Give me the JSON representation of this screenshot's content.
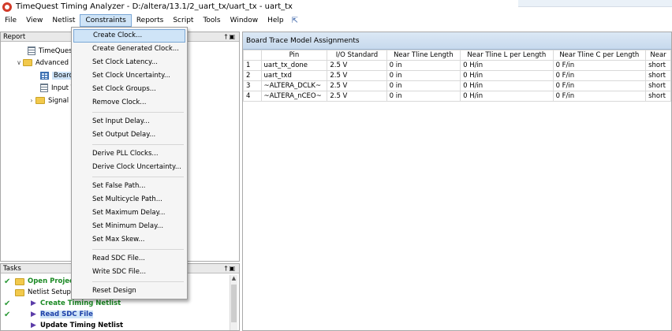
{
  "window": {
    "title": "TimeQuest Timing Analyzer - D:/altera/13.1/2_uart_tx/uart_tx - uart_tx"
  },
  "menubar": {
    "items": [
      "File",
      "View",
      "Netlist",
      "Constraints",
      "Reports",
      "Script",
      "Tools",
      "Window",
      "Help"
    ],
    "active": "Constraints"
  },
  "report_panel": {
    "title": "Report",
    "tree": [
      {
        "label": "TimeQuest",
        "icon": "document-icon"
      },
      {
        "label": "Advanced",
        "icon": "folder-icon"
      },
      {
        "label": "Board",
        "icon": "table-icon"
      },
      {
        "label": "Input T",
        "icon": "document-icon"
      },
      {
        "label": "Signal",
        "icon": "folder-icon"
      }
    ]
  },
  "tasks_panel": {
    "title": "Tasks",
    "items": [
      {
        "label": "Open Project"
      },
      {
        "label": "Netlist Setup"
      },
      {
        "label": "Create Timing Netlist"
      },
      {
        "label": "Read SDC File"
      },
      {
        "label": "Update Timing Netlist"
      }
    ]
  },
  "constraints_menu": {
    "groups": [
      [
        "Create Clock...",
        "Create Generated Clock...",
        "Set Clock Latency...",
        "Set Clock Uncertainty...",
        "Set Clock Groups...",
        "Remove Clock..."
      ],
      [
        "Set Input Delay...",
        "Set Output Delay..."
      ],
      [
        "Derive PLL Clocks...",
        "Derive Clock Uncertainty..."
      ],
      [
        "Set False Path...",
        "Set Multicycle Path...",
        "Set Maximum Delay...",
        "Set Minimum Delay...",
        "Set Max Skew..."
      ],
      [
        "Read SDC File...",
        "Write SDC File..."
      ],
      [
        "Reset Design"
      ]
    ],
    "highlighted": "Create Clock..."
  },
  "board_trace": {
    "title": "Board Trace Model Assignments",
    "columns": [
      "",
      "Pin",
      "I/O Standard",
      "Near Tline Length",
      "Near Tline L per Length",
      "Near Tline C per Length",
      "Near"
    ],
    "rows": [
      [
        "1",
        "uart_tx_done",
        "2.5 V",
        "0 in",
        "0 H/in",
        "0 F/in",
        "short"
      ],
      [
        "2",
        "uart_txd",
        "2.5 V",
        "0 in",
        "0 H/in",
        "0 F/in",
        "short"
      ],
      [
        "3",
        "~ALTERA_DCLK~",
        "2.5 V",
        "0 in",
        "0 H/in",
        "0 F/in",
        "short"
      ],
      [
        "4",
        "~ALTERA_nCEO~",
        "2.5 V",
        "0 in",
        "0 H/in",
        "0 F/in",
        "short"
      ]
    ]
  },
  "colors": {
    "accent": "#cfe4f7",
    "menu_border": "#7aa7d6",
    "task_done": "#1c8a25",
    "task_link": "#1b3fa8"
  }
}
